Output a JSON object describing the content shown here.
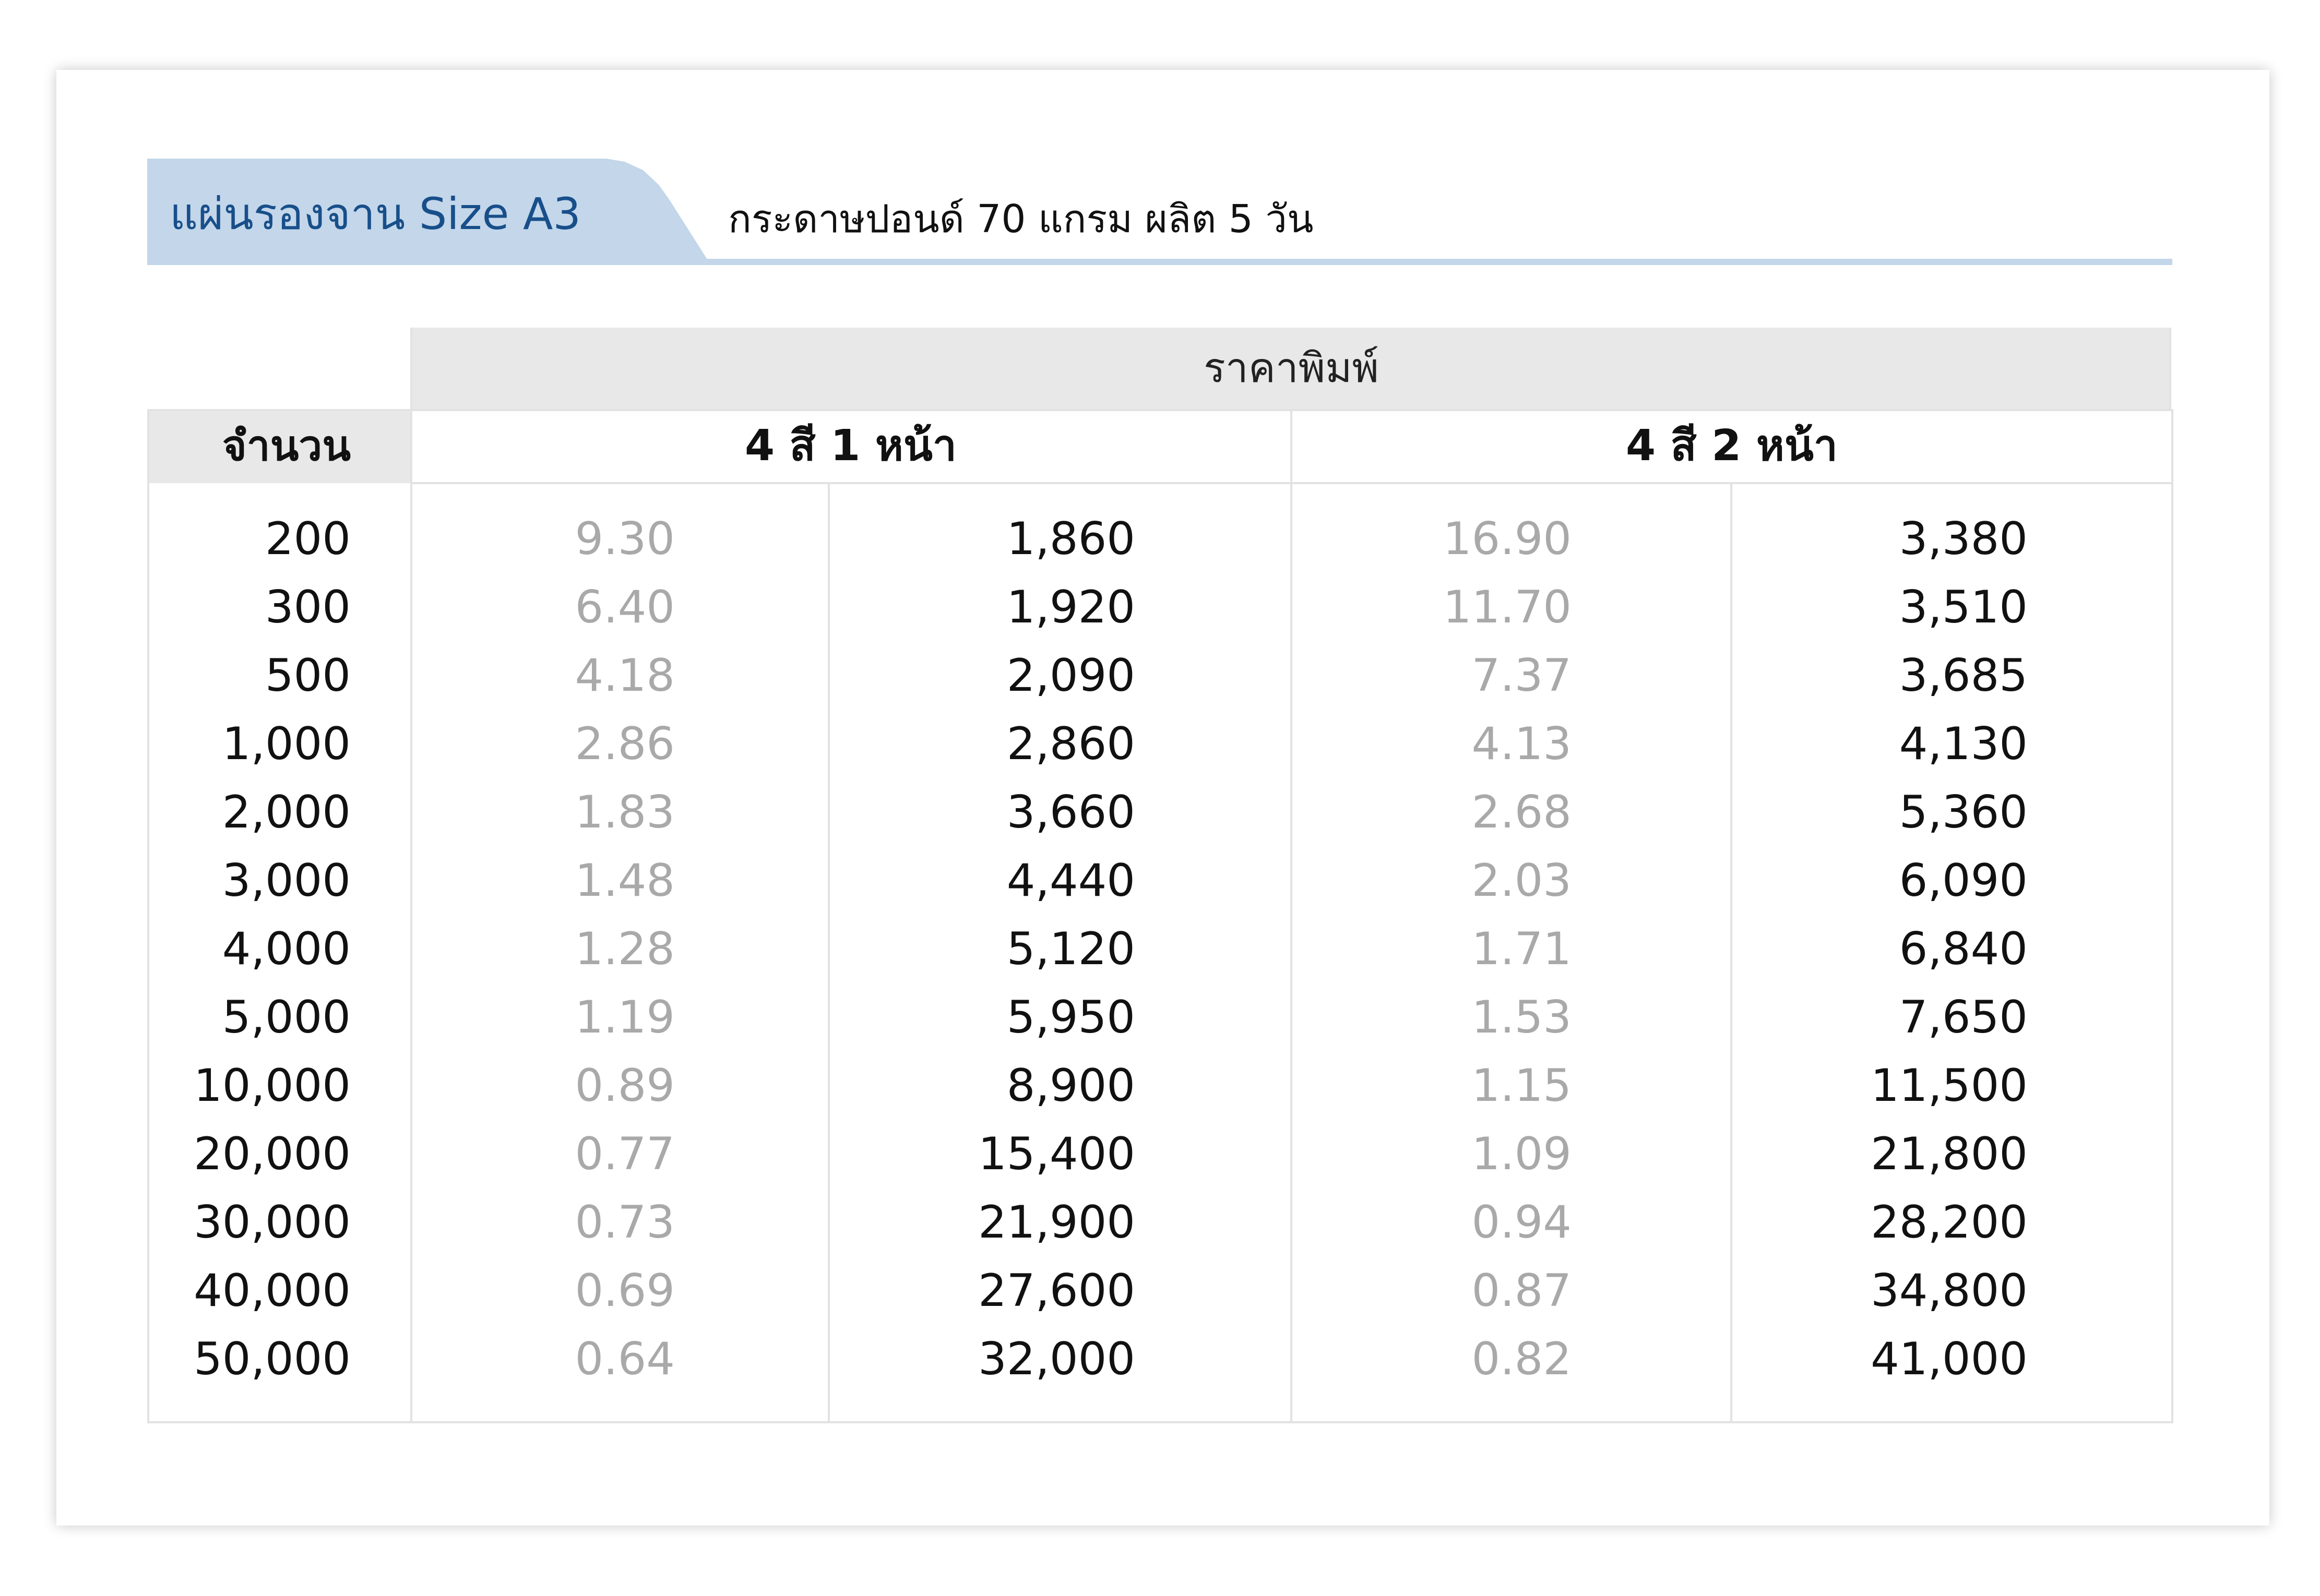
{
  "header": {
    "title": "แผ่นรองจาน Size A3",
    "subtitle": "กระดาษปอนด์ 70 แกรม ผลิต 5 วัน"
  },
  "table": {
    "group_header": "ราคาพิมพ์",
    "quantity_header": "จำนวน",
    "column_headers": [
      "4 สี 1 หน้า",
      "4 สี 2 หน้า"
    ],
    "rows": [
      {
        "qty": "200",
        "unit_1": "9.30",
        "total_1": "1,860",
        "unit_2": "16.90",
        "total_2": "3,380"
      },
      {
        "qty": "300",
        "unit_1": "6.40",
        "total_1": "1,920",
        "unit_2": "11.70",
        "total_2": "3,510"
      },
      {
        "qty": "500",
        "unit_1": "4.18",
        "total_1": "2,090",
        "unit_2": "7.37",
        "total_2": "3,685"
      },
      {
        "qty": "1,000",
        "unit_1": "2.86",
        "total_1": "2,860",
        "unit_2": "4.13",
        "total_2": "4,130"
      },
      {
        "qty": "2,000",
        "unit_1": "1.83",
        "total_1": "3,660",
        "unit_2": "2.68",
        "total_2": "5,360"
      },
      {
        "qty": "3,000",
        "unit_1": "1.48",
        "total_1": "4,440",
        "unit_2": "2.03",
        "total_2": "6,090"
      },
      {
        "qty": "4,000",
        "unit_1": "1.28",
        "total_1": "5,120",
        "unit_2": "1.71",
        "total_2": "6,840"
      },
      {
        "qty": "5,000",
        "unit_1": "1.19",
        "total_1": "5,950",
        "unit_2": "1.53",
        "total_2": "7,650"
      },
      {
        "qty": "10,000",
        "unit_1": "0.89",
        "total_1": "8,900",
        "unit_2": "1.15",
        "total_2": "11,500"
      },
      {
        "qty": "20,000",
        "unit_1": "0.77",
        "total_1": "15,400",
        "unit_2": "1.09",
        "total_2": "21,800"
      },
      {
        "qty": "30,000",
        "unit_1": "0.73",
        "total_1": "21,900",
        "unit_2": "0.94",
        "total_2": "28,200"
      },
      {
        "qty": "40,000",
        "unit_1": "0.69",
        "total_1": "27,600",
        "unit_2": "0.87",
        "total_2": "34,800"
      },
      {
        "qty": "50,000",
        "unit_1": "0.64",
        "total_1": "32,000",
        "unit_2": "0.82",
        "total_2": "41,000"
      }
    ]
  },
  "colors": {
    "header_tab": "#c3d6ea",
    "header_title": "#184f8a",
    "band_gray": "#e8e8e8",
    "unit_price_text": "#a9a9a9",
    "total_price_text": "#111111"
  }
}
